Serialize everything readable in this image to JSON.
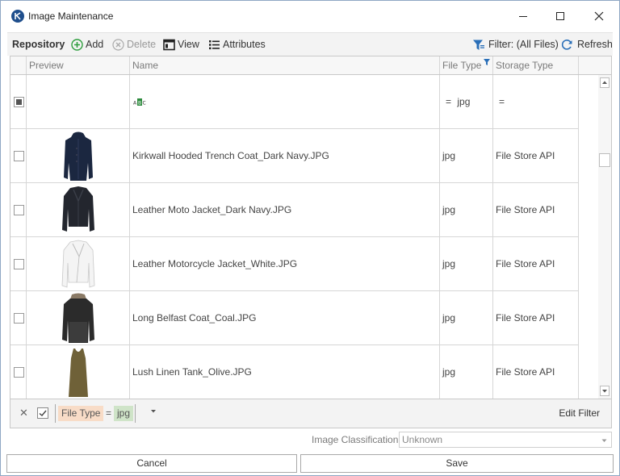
{
  "window": {
    "title": "Image Maintenance"
  },
  "toolbar": {
    "repository_label": "Repository",
    "add_label": "Add",
    "delete_label": "Delete",
    "view_label": "View",
    "attributes_label": "Attributes",
    "filter_label": "Filter: (All Files)",
    "refresh_label": "Refresh"
  },
  "grid": {
    "columns": [
      "Preview",
      "Name",
      "File Type",
      "Storage Type"
    ],
    "filter_row": {
      "file_type_op": "=",
      "file_type_value": "jpg",
      "storage_type_op": "="
    },
    "rows": [
      {
        "name": "Kirkwall Hooded Trench Coat_Dark Navy.JPG",
        "file_type": "jpg",
        "storage_type": "File Store API",
        "thumb": "coat-navy"
      },
      {
        "name": "Leather Moto Jacket_Dark Navy.JPG",
        "file_type": "jpg",
        "storage_type": "File Store API",
        "thumb": "jacket-navy"
      },
      {
        "name": "Leather Motorcycle Jacket_White.JPG",
        "file_type": "jpg",
        "storage_type": "File Store API",
        "thumb": "jacket-white"
      },
      {
        "name": "Long Belfast Coat_Coal.JPG",
        "file_type": "jpg",
        "storage_type": "File Store API",
        "thumb": "coat-coal"
      },
      {
        "name": "Lush Linen Tank_Olive.JPG",
        "file_type": "jpg",
        "storage_type": "File Store API",
        "thumb": "tank-olive"
      }
    ]
  },
  "filter_bar": {
    "field": "File Type",
    "operator": "=",
    "value": "jpg",
    "edit_label": "Edit Filter"
  },
  "classification": {
    "label": "Image Classification",
    "value": "Unknown"
  },
  "buttons": {
    "cancel": "Cancel",
    "save": "Save"
  },
  "colors": {
    "add_green": "#2e9e3e",
    "filter_blue": "#2a6fb8",
    "field_pill": "#f8dcc7",
    "value_pill": "#cfe4c8"
  }
}
